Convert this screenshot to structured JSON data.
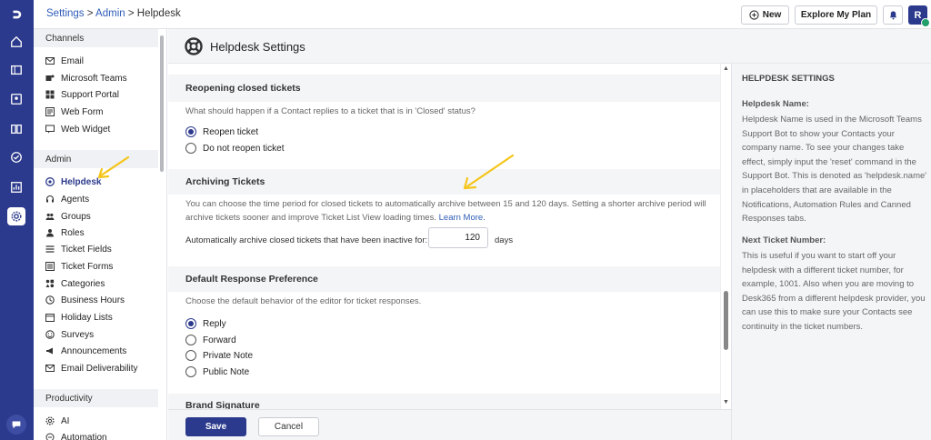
{
  "breadcrumb": {
    "settings": "Settings",
    "sep1": " > ",
    "admin": "Admin",
    "sep2": " > ",
    "current": "Helpdesk"
  },
  "topbar": {
    "new_label": "New",
    "explore_label": "Explore My Plan",
    "avatar_initial": "R"
  },
  "sidebar": {
    "channels_header": "Channels",
    "channels": [
      "Email",
      "Microsoft Teams",
      "Support Portal",
      "Web Form",
      "Web Widget"
    ],
    "admin_header": "Admin",
    "admin": [
      "Helpdesk",
      "Agents",
      "Groups",
      "Roles",
      "Ticket Fields",
      "Ticket Forms",
      "Categories",
      "Business Hours",
      "Holiday Lists",
      "Surveys",
      "Announcements",
      "Email Deliverability"
    ],
    "productivity_header": "Productivity",
    "productivity": [
      "AI",
      "Automation"
    ],
    "active": "Helpdesk"
  },
  "page": {
    "title": "Helpdesk Settings"
  },
  "reopening": {
    "title": "Reopening closed tickets",
    "question": "What should happen if a Contact replies to a ticket that is in 'Closed' status?",
    "options": [
      "Reopen ticket",
      "Do not reopen ticket"
    ],
    "selected": "Reopen ticket"
  },
  "archiving": {
    "title": "Archiving Tickets",
    "desc1": "You can choose the time period for closed tickets to automatically archive between 15 and 120 days. Setting a shorter archive period will",
    "desc2": "archive tickets sooner and improve Ticket List View loading times. ",
    "learn_more": "Learn More.",
    "field_label": "Automatically archive closed tickets that have been inactive for:",
    "value": "120",
    "unit": "days"
  },
  "response_pref": {
    "title": "Default Response Preference",
    "desc": "Choose the default behavior of the editor for ticket responses.",
    "options": [
      "Reply",
      "Forward",
      "Private Note",
      "Public Note"
    ],
    "selected": "Reply"
  },
  "brand": {
    "title": "Brand Signature"
  },
  "footer": {
    "save": "Save",
    "cancel": "Cancel"
  },
  "help": {
    "title": "HELPDESK SETTINGS",
    "name_heading": "Helpdesk Name:",
    "name_lines": [
      "Helpdesk Name is used in the Microsoft Teams",
      "Support Bot to show your Contacts your",
      "company name. To see your changes take",
      "effect, simply input the 'reset' command in the",
      "Support Bot. This is denoted as 'helpdesk.name'",
      "in placeholders that are available in the",
      "Notifications, Automation Rules and Canned",
      "Responses tabs."
    ],
    "next_heading": "Next Ticket Number:",
    "next_lines": [
      "This is useful if you want to start off your",
      "helpdesk with a different ticket number, for",
      "example, 1001. Also when you are moving to",
      "Desk365 from a different helpdesk provider, you",
      "can use this to make sure your Contacts see",
      "continuity in the ticket numbers."
    ]
  },
  "colors": {
    "brand": "#2b3a8c",
    "link": "#2e5cb8",
    "annotation_arrow": "#f5c518",
    "online": "#22a06b"
  }
}
